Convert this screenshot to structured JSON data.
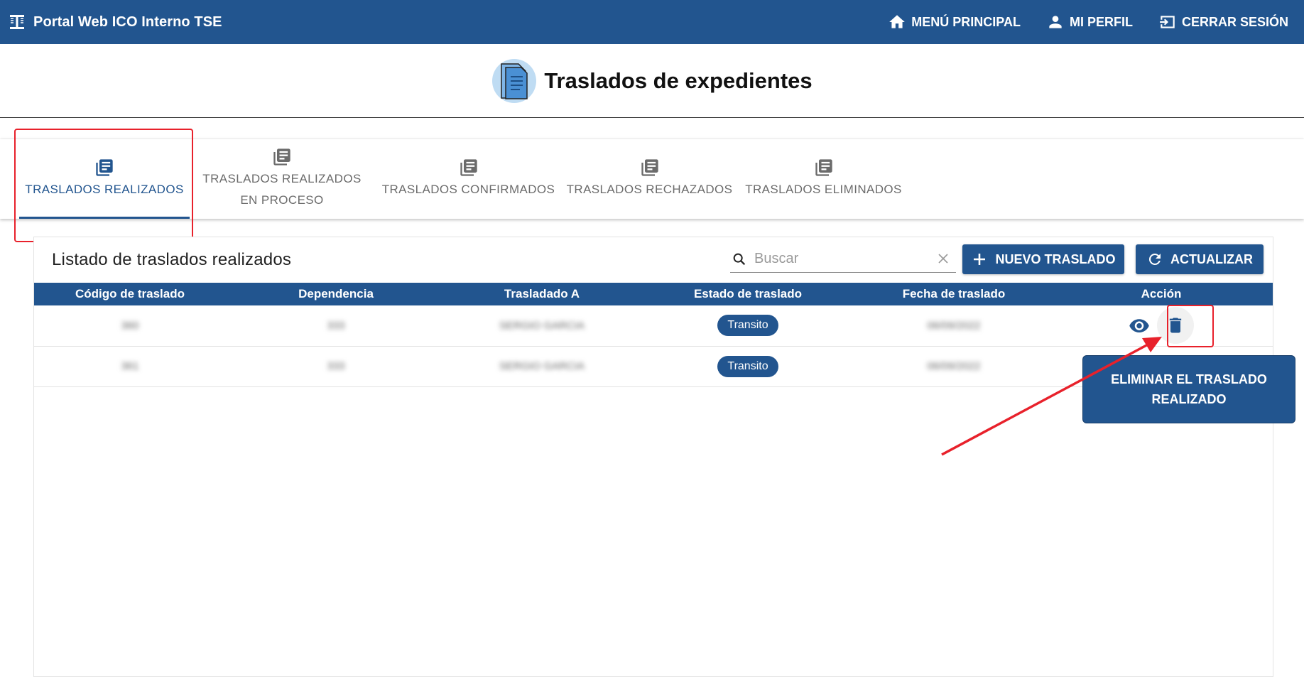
{
  "app": {
    "title": "Portal Web ICO Interno TSE",
    "nav": [
      {
        "icon": "home-icon",
        "label": "MENÚ PRINCIPAL"
      },
      {
        "icon": "person-icon",
        "label": "MI PERFIL"
      },
      {
        "icon": "logout-icon",
        "label": "CERRAR SESIÓN"
      }
    ]
  },
  "header": {
    "title": "Traslados de expedientes",
    "icon": "document-icon"
  },
  "tabs": [
    {
      "label": "TRASLADOS REALIZADOS",
      "active": true
    },
    {
      "label_line1": "TRASLADOS REALIZADOS",
      "label_line2": "EN PROCESO",
      "active": false
    },
    {
      "label": "TRASLADOS CONFIRMADOS",
      "active": false
    },
    {
      "label": "TRASLADOS RECHAZADOS",
      "active": false
    },
    {
      "label": "TRASLADOS ELIMINADOS",
      "active": false
    }
  ],
  "panel": {
    "title": "Listado de traslados realizados",
    "search": {
      "placeholder": "Buscar",
      "value": ""
    },
    "new_button": "NUEVO TRASLADO",
    "refresh_button": "ACTUALIZAR"
  },
  "table": {
    "columns": [
      "Código de traslado",
      "Dependencia",
      "Trasladado A",
      "Estado de traslado",
      "Fecha de traslado",
      "Acción"
    ],
    "rows": [
      {
        "codigo": "360",
        "dependencia": "333",
        "trasladado": "SERGIO GARCIA",
        "estado": "Transito",
        "fecha": "06/09/2022"
      },
      {
        "codigo": "361",
        "dependencia": "333",
        "trasladado": "SERGIO GARCIA",
        "estado": "Transito",
        "fecha": "06/09/2022"
      }
    ]
  },
  "tooltip": {
    "text": "ELIMINAR EL TRASLADO REALIZADO"
  },
  "colors": {
    "primary": "#22558f",
    "annotation": "#e8212b"
  }
}
